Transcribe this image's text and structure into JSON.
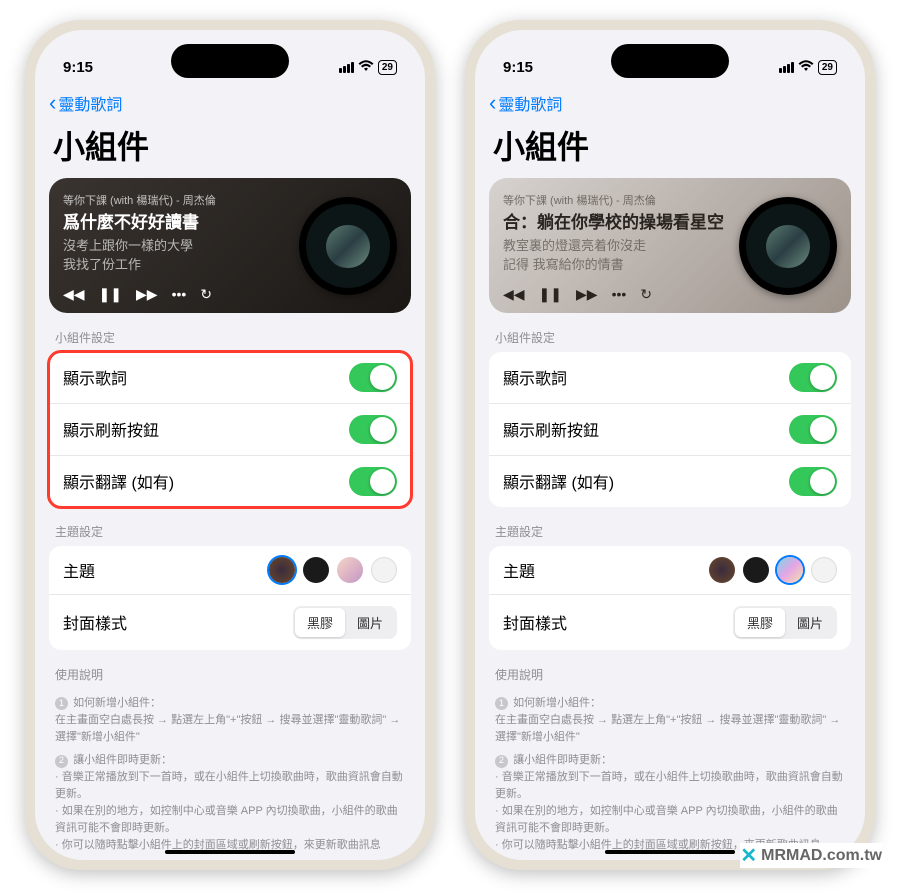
{
  "statusbar": {
    "time": "9:15",
    "battery": "29"
  },
  "nav": {
    "back_label": "靈動歌詞"
  },
  "page_title": "小組件",
  "left": {
    "theme_class": "wc-dark",
    "song_sub": "等你下課 (with 楊瑞代) - 周杰倫",
    "song_main": "爲什麼不好好讀書",
    "lyric_lines": [
      "沒考上跟你一樣的大學",
      "我找了份工作"
    ],
    "swatch_selected": 0
  },
  "right": {
    "theme_class": "wc-light",
    "song_sub": "等你下課 (with 楊瑞代) - 周杰倫",
    "song_main": "合：躺在你學校的操場看星空",
    "lyric_lines": [
      "教室裏的燈還亮着你沒走",
      "記得 我寫給你的情書"
    ],
    "swatch_selected": 2
  },
  "section_widget": "小組件設定",
  "toggles": {
    "show_lyrics": "顯示歌詞",
    "show_refresh": "顯示刷新按鈕",
    "show_translate": "顯示翻譯 (如有)"
  },
  "section_theme": "主題設定",
  "theme_row": "主題",
  "cover_row": "封面樣式",
  "seg": {
    "vinyl": "黑膠",
    "image": "圖片"
  },
  "section_help": "使用說明",
  "help": {
    "step1_title": "如何新增小組件：",
    "step1_body": "在主畫面空白處長按 → 點選左上角\"+\"按鈕 → 搜尋並選擇\"靈動歌詞\" → 選擇\"新增小組件\"",
    "step2_title": "讓小組件即時更新：",
    "step2_body1": "音樂正常播放到下一首時，或在小組件上切換歌曲時，歌曲資訊會自動更新。",
    "step2_body2": "如果在別的地方，如控制中心或音樂 APP 內切換歌曲，小組件的歌曲資訊可能不會即時更新。",
    "step2_body3": "你可以隨時點擊小組件上的封面區域或刷新按鈕，來更新歌曲訊息"
  },
  "watermark": "MRMAD.com.tw"
}
